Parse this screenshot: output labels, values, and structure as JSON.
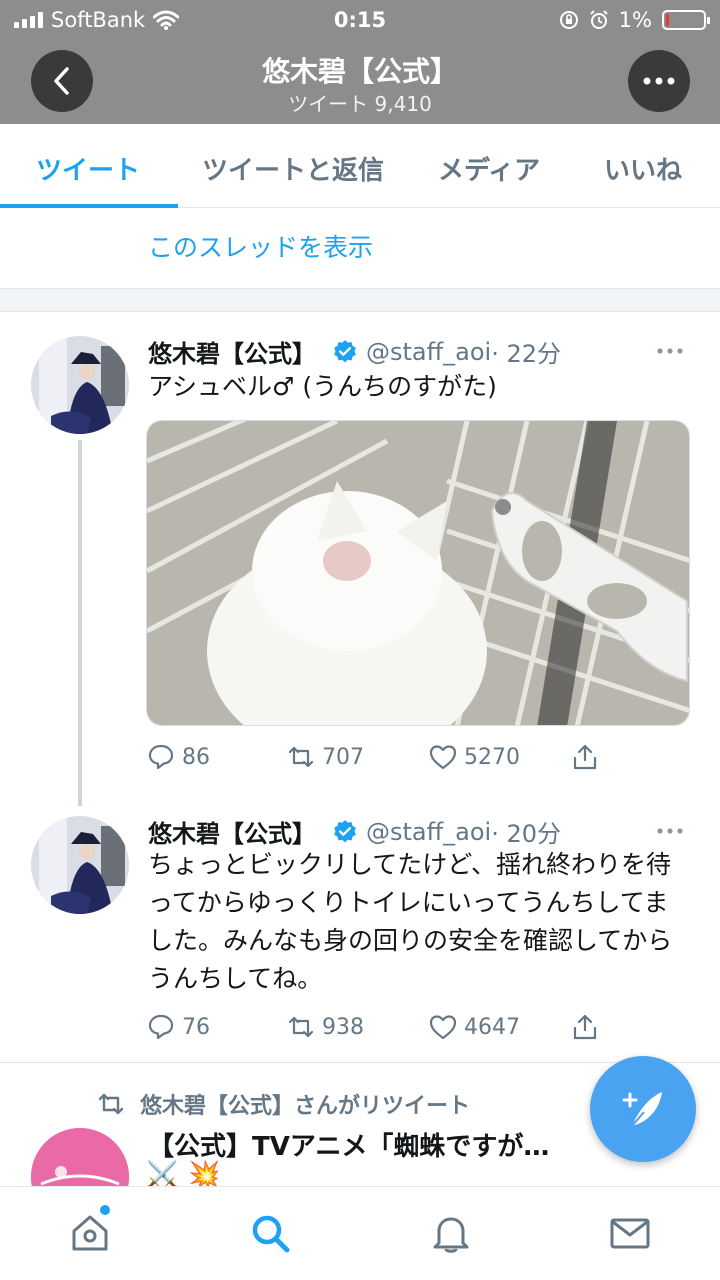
{
  "status_bar": {
    "carrier": "SoftBank",
    "time": "0:15",
    "battery": "1%",
    "battery_level": 0.01
  },
  "header": {
    "title": "悠木碧【公式】",
    "subtitle": "ツイート 9,410",
    "back_icon": "chevron-left-icon",
    "more_icon": "more-horizontal-icon"
  },
  "tabs": [
    {
      "label": "ツイート",
      "active": true
    },
    {
      "label": "ツイートと返信",
      "active": false
    },
    {
      "label": "メディア",
      "active": false
    },
    {
      "label": "いいね",
      "active": false
    }
  ],
  "thread_link": "このスレッドを表示",
  "tweets": [
    {
      "name": "悠木碧【公式】",
      "handle": "@staff_aoi",
      "time": "· 22分",
      "text": "アシュベル♂ (うんちのすがた)",
      "replies": "86",
      "retweets": "707",
      "likes": "5270"
    },
    {
      "name": "悠木碧【公式】",
      "handle": "@staff_aoi",
      "time": "· 20分",
      "text": "ちょっとビックリしてたけど、揺れ終わりを待ってからゆっくりトイレにいってうんちしてました。みんなも身の回りの安全を確認してからうんちしてね。",
      "replies": "76",
      "retweets": "938",
      "likes": "4647"
    }
  ],
  "retweet_notice": "悠木碧【公式】さんがリツイート",
  "retweeted_tweet": {
    "text": "【公式】TVアニメ「蜘蛛ですが…",
    "emoji": [
      "⚔️",
      "💥"
    ]
  },
  "colors": {
    "accent": "#1da1f2",
    "header_bg": "#8d8d8d",
    "secondary_text": "#657786"
  }
}
